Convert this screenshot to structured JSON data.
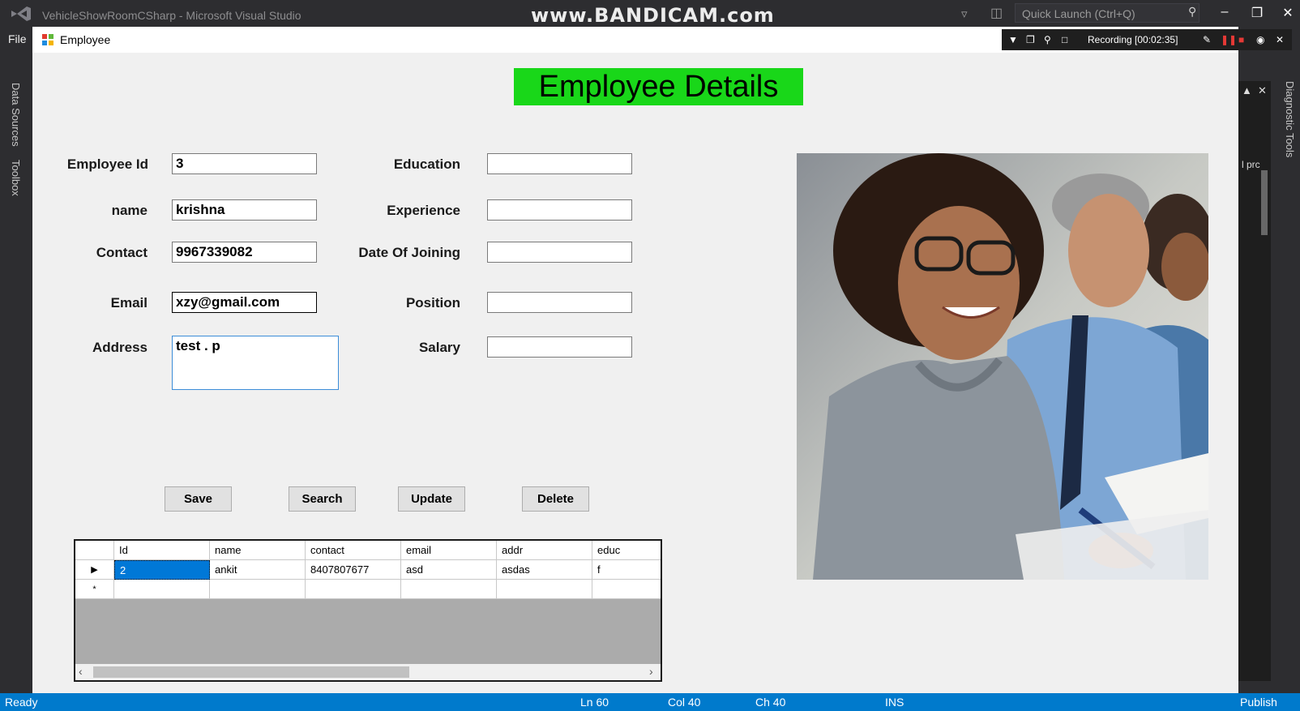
{
  "vs": {
    "window_title": "VehicleShowRoomCSharp - Microsoft Visual Studio",
    "watermark": "www.BANDICAM.com",
    "quick_launch_placeholder": "Quick Launch (Ctrl+Q)",
    "menu_file": "File",
    "side_tabs": [
      "Data Sources",
      "Toolbox"
    ],
    "right_tab": "Diagnostic Tools",
    "right_panel_text": "l prc",
    "status": {
      "ready": "Ready",
      "ln": "Ln 60",
      "col": "Col 40",
      "ch": "Ch 40",
      "ins": "INS",
      "publish": "Publish"
    }
  },
  "recording": {
    "label": "Recording [00:02:35]"
  },
  "form": {
    "title": "Employee",
    "heading": "Employee Details",
    "fields_left": [
      {
        "label": "Employee Id",
        "value": "3"
      },
      {
        "label": "name",
        "value": "krishna"
      },
      {
        "label": "Contact",
        "value": "9967339082"
      },
      {
        "label": "Email",
        "value": "xzy@gmail.com"
      },
      {
        "label": "Address",
        "value": "test . p"
      }
    ],
    "fields_right": [
      {
        "label": "Education",
        "value": ""
      },
      {
        "label": "Experience",
        "value": ""
      },
      {
        "label": "Date Of Joining",
        "value": ""
      },
      {
        "label": "Position",
        "value": ""
      },
      {
        "label": "Salary",
        "value": ""
      }
    ],
    "buttons": {
      "save": "Save",
      "search": "Search",
      "update": "Update",
      "delete": "Delete"
    },
    "grid": {
      "columns": [
        "Id",
        "name",
        "contact",
        "email",
        "addr",
        "educ"
      ],
      "rows": [
        [
          "2",
          "ankit",
          "8407807677",
          "asd",
          "asdas",
          "f"
        ]
      ],
      "new_row_marker": "*",
      "current_row_marker": "▶"
    }
  },
  "colors": {
    "heading_bg": "#19d719",
    "statusbar": "#007acc",
    "selection": "#0078d7"
  }
}
